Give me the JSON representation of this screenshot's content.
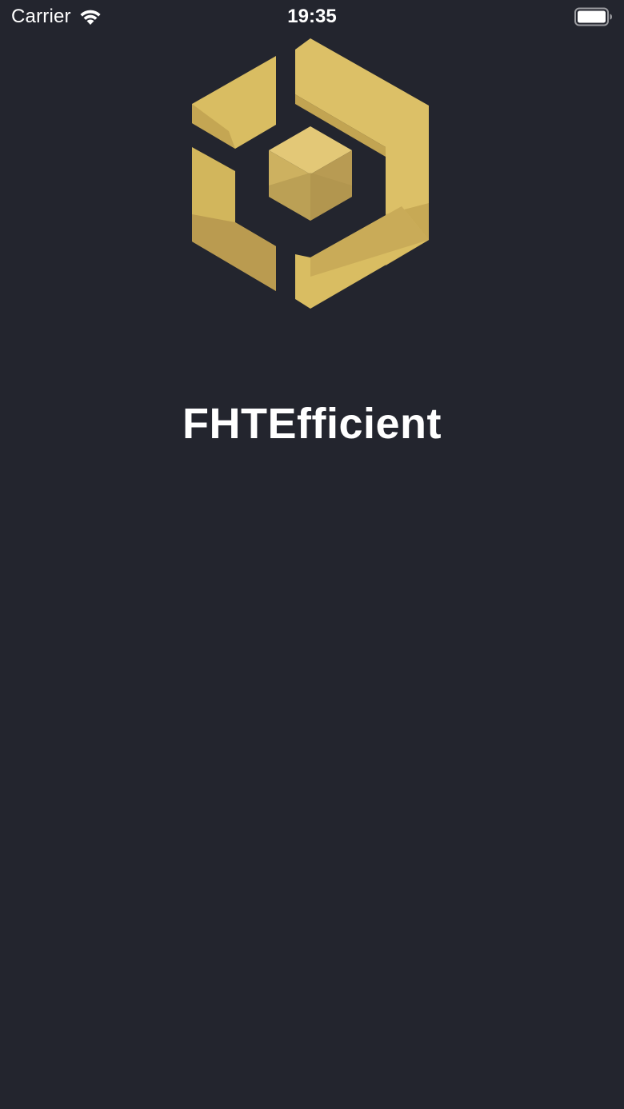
{
  "status_bar": {
    "carrier": "Carrier",
    "time": "19:35",
    "wifi_icon": "wifi-icon",
    "battery_icon": "battery-full-icon"
  },
  "splash": {
    "logo_icon": "gold-hexagon-cube-logo",
    "app_title": "FHTEfficient"
  },
  "colors": {
    "background": "#23252e",
    "logo_gold": "#d9bd62",
    "logo_gold_dark": "#b1954f",
    "text": "#ffffff"
  }
}
